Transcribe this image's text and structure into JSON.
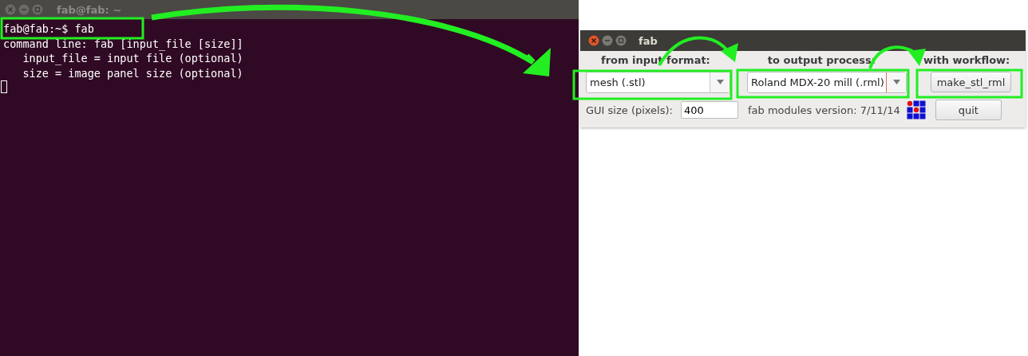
{
  "terminal": {
    "title": "fab@fab: ~",
    "lines": [
      "fab@fab:~$ fab",
      "command line: fab [input_file [size]]",
      "   input_file = input file (optional)",
      "   size = image panel size (optional)"
    ],
    "cursor": true
  },
  "fab_window": {
    "title": "fab",
    "headers": [
      "from input format:",
      "to output process:",
      "with workflow:"
    ],
    "input_format": {
      "value": "mesh (.stl)"
    },
    "output_process": {
      "value": "Roland MDX-20 mill (.rml)"
    },
    "workflow_button": "make_stl_rml",
    "gui_size": {
      "label": "GUI size (pixels):",
      "value": "400"
    },
    "version": "fab modules version: 7/11/14",
    "quit_button": "quit"
  }
}
